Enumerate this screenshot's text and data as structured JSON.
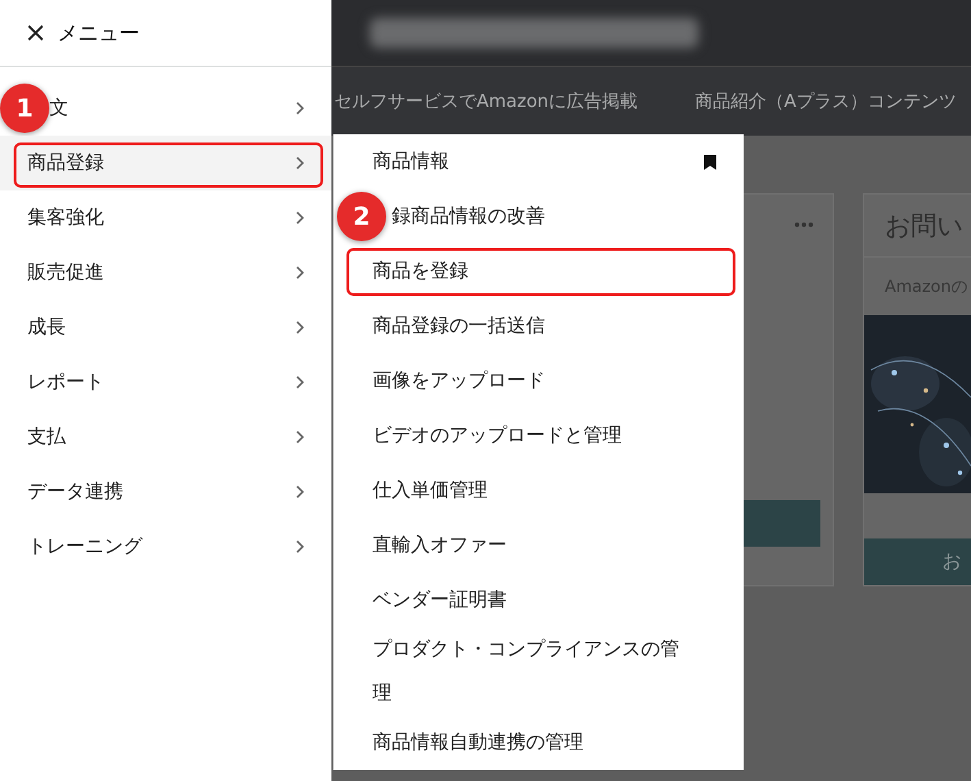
{
  "background": {
    "nav_links": [
      "セルフサービスでAmazonに広告掲載",
      "商品紹介（Aプラス）コンテンツ"
    ],
    "card": {
      "title": "お問い",
      "subtitle": "Amazonの",
      "button": "お"
    }
  },
  "menu": {
    "title": "メニュー",
    "items": [
      {
        "label": "文",
        "badge": "1",
        "selected": false,
        "highlighted": false
      },
      {
        "label": "商品登録",
        "selected": true,
        "highlighted": true
      },
      {
        "label": "集客強化",
        "selected": false,
        "highlighted": false
      },
      {
        "label": "販売促進",
        "selected": false,
        "highlighted": false
      },
      {
        "label": "成長",
        "selected": false,
        "highlighted": false
      },
      {
        "label": "レポート",
        "selected": false,
        "highlighted": false
      },
      {
        "label": "支払",
        "selected": false,
        "highlighted": false
      },
      {
        "label": "データ連携",
        "selected": false,
        "highlighted": false
      },
      {
        "label": "トレーニング",
        "selected": false,
        "highlighted": false
      }
    ]
  },
  "submenu": {
    "items": [
      {
        "label": "商品情報",
        "bookmarked": true,
        "highlighted": false
      },
      {
        "label": "録商品情報の改善",
        "badge": "2",
        "bookmarked": false,
        "highlighted": false
      },
      {
        "label": "商品を登録",
        "bookmarked": false,
        "highlighted": true
      },
      {
        "label": "商品登録の一括送信",
        "bookmarked": false,
        "highlighted": false
      },
      {
        "label": "画像をアップロード",
        "bookmarked": false,
        "highlighted": false
      },
      {
        "label": "ビデオのアップロードと管理",
        "bookmarked": false,
        "highlighted": false
      },
      {
        "label": "仕入単価管理",
        "bookmarked": false,
        "highlighted": false
      },
      {
        "label": "直輸入オファー",
        "bookmarked": false,
        "highlighted": false
      },
      {
        "label": "ベンダー証明書",
        "bookmarked": false,
        "highlighted": false
      },
      {
        "label": "プロダクト・コンプライアンスの管理",
        "bookmarked": false,
        "highlighted": false
      },
      {
        "label": "商品情報自動連携の管理",
        "bookmarked": false,
        "highlighted": false
      }
    ]
  }
}
